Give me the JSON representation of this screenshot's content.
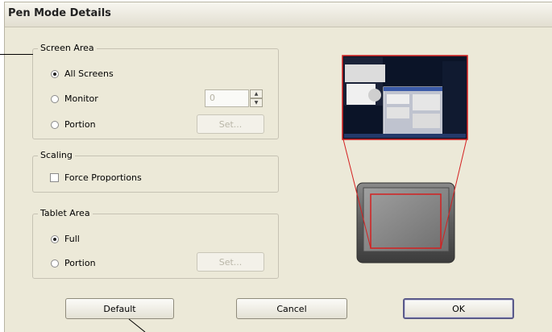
{
  "dialog": {
    "title": "Pen Mode Details"
  },
  "screen_area": {
    "legend": "Screen Area",
    "all_screens_label": "All Screens",
    "monitor_label": "Monitor",
    "portion_label": "Portion",
    "monitor_value": "0",
    "set_label": "Set...",
    "selected": "All Screens"
  },
  "scaling": {
    "legend": "Scaling",
    "force_proportions_label": "Force Proportions",
    "force_proportions_checked": false
  },
  "tablet_area": {
    "legend": "Tablet Area",
    "full_label": "Full",
    "portion_label": "Portion",
    "set_label": "Set...",
    "selected": "Full"
  },
  "buttons": {
    "default": "Default",
    "cancel": "Cancel",
    "ok": "OK"
  },
  "colors": {
    "mapping_lines": "#d42020",
    "dialog_bg": "#ece9d8",
    "group_border": "#c6c2b3"
  },
  "icons": {
    "spinner_up": "▲",
    "spinner_down": "▼"
  }
}
